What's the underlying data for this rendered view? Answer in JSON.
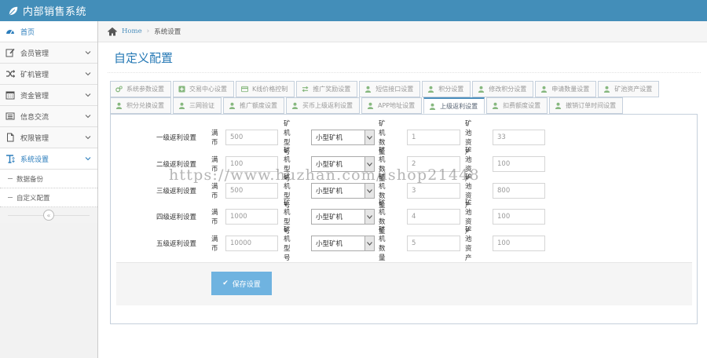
{
  "app": {
    "title": "内部销售系统"
  },
  "sidebar": {
    "items": [
      {
        "label": "首页",
        "icon": "dashboard-icon"
      },
      {
        "label": "会员管理",
        "icon": "edit-icon"
      },
      {
        "label": "矿机管理",
        "icon": "shuffle-icon"
      },
      {
        "label": "资金管理",
        "icon": "calendar-icon"
      },
      {
        "label": "信息交流",
        "icon": "list-icon"
      },
      {
        "label": "权限管理",
        "icon": "file-icon"
      },
      {
        "label": "系统设置",
        "icon": "text-icon"
      }
    ],
    "subitems": [
      {
        "label": "数据备份"
      },
      {
        "label": "自定义配置"
      }
    ],
    "collapse_glyph": "«"
  },
  "breadcrumb": {
    "home": "Home",
    "separator": "›",
    "current": "系统设置"
  },
  "page": {
    "title": "自定义配置"
  },
  "tabs": {
    "row1": [
      "系统参数设置",
      "交易中心设置",
      "K线价格控制",
      "推广奖励设置",
      "短信接口设置",
      "积分设置",
      "修改积分设置",
      "申请数量设置",
      "矿池资产设置"
    ],
    "row2": [
      "积分兑换设置",
      "三网验证",
      "推广额度设置",
      "买币上级返利设置",
      "APP地址设置",
      "上级返利设置",
      "扣费额度设置",
      "撤销订单时间设置"
    ],
    "active": "上级返利设置"
  },
  "form": {
    "field_labels": {
      "coin": "满币",
      "model": "矿机型号",
      "qty": "矿机数量",
      "assets": "矿池资产"
    },
    "rows": [
      {
        "level": "一级返利设置",
        "coin": "500",
        "model": "小型矿机",
        "qty": "1",
        "assets": "33"
      },
      {
        "level": "二级返利设置",
        "coin": "100",
        "model": "小型矿机",
        "qty": "2",
        "assets": "100"
      },
      {
        "level": "三级返利设置",
        "coin": "500",
        "model": "小型矿机",
        "qty": "3",
        "assets": "800"
      },
      {
        "level": "四级返利设置",
        "coin": "1000",
        "model": "小型矿机",
        "qty": "4",
        "assets": "100"
      },
      {
        "level": "五级返利设置",
        "coin": "10000",
        "model": "小型矿机",
        "qty": "5",
        "assets": "100"
      }
    ],
    "save_label": "保存设置"
  },
  "watermark": "https://www.huzhan.com/ishop21448",
  "colors": {
    "topbar": "#438eb9",
    "accent": "#2679b5",
    "tab_icon": "#87b87f",
    "button": "#6fb3e0"
  }
}
